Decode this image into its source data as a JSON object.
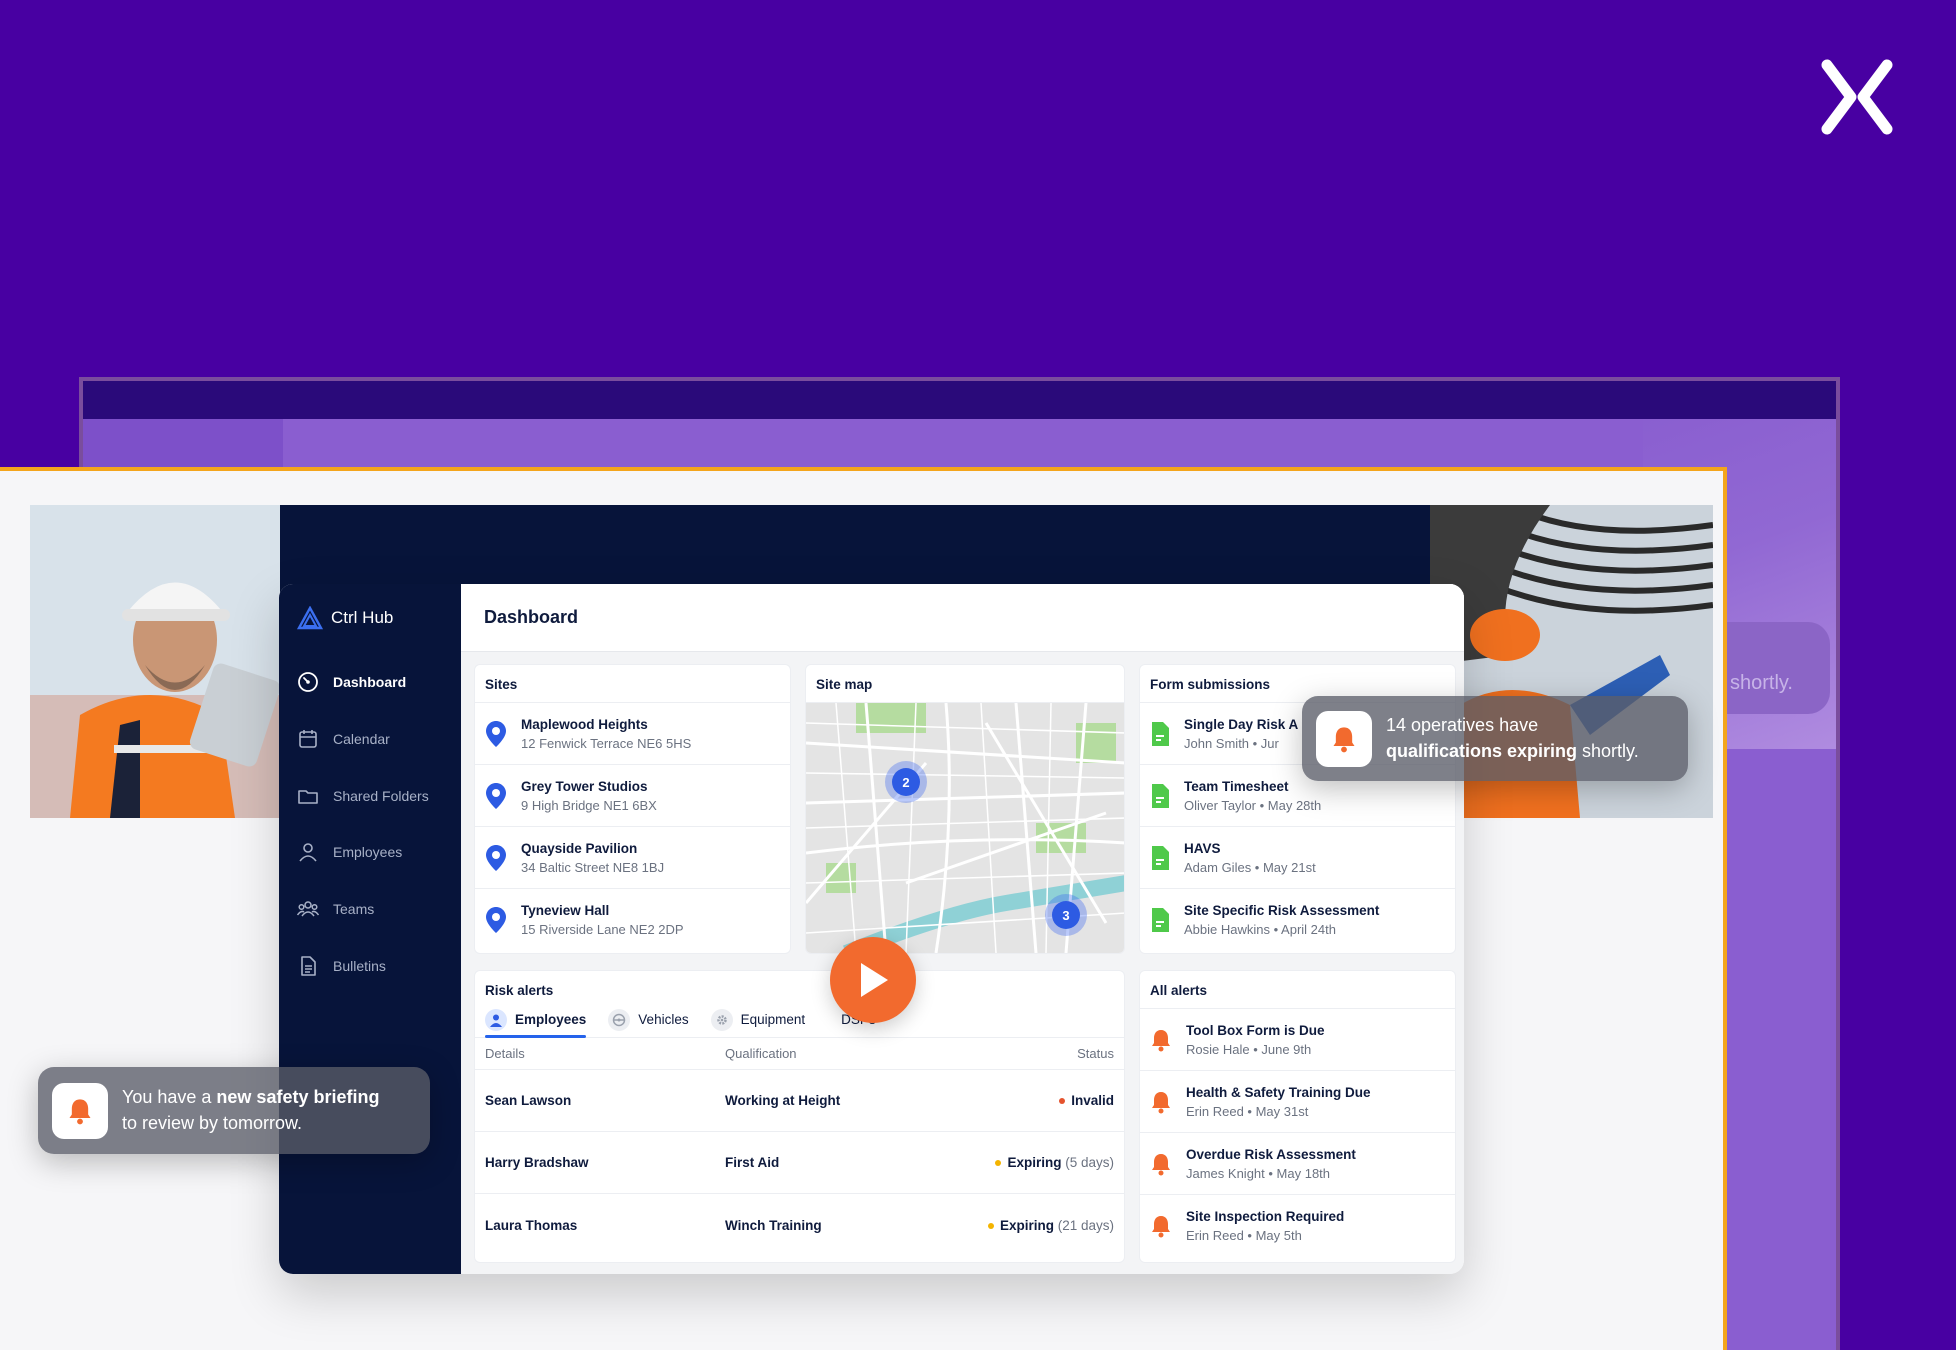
{
  "app": {
    "name": "Ctrl Hub",
    "page_title": "Dashboard"
  },
  "colors": {
    "background": "#4800a2",
    "accent": "#f4a51c",
    "sidebar": "#07143a",
    "primary": "#2563eb",
    "alert": "#f26a2e",
    "form_icon": "#4fc94a"
  },
  "sidebar": {
    "items": [
      {
        "label": "Dashboard",
        "icon": "gauge-icon",
        "active": true
      },
      {
        "label": "Calendar",
        "icon": "calendar-icon",
        "active": false
      },
      {
        "label": "Shared Folders",
        "icon": "folder-icon",
        "active": false
      },
      {
        "label": "Employees",
        "icon": "person-icon",
        "active": false
      },
      {
        "label": "Teams",
        "icon": "group-icon",
        "active": false
      },
      {
        "label": "Bulletins",
        "icon": "document-icon",
        "active": false
      }
    ]
  },
  "sites": {
    "title": "Sites",
    "items": [
      {
        "name": "Maplewood Heights",
        "address": "12 Fenwick Terrace NE6 5HS"
      },
      {
        "name": "Grey Tower Studios",
        "address": "9 High Bridge NE1 6BX"
      },
      {
        "name": "Quayside Pavilion",
        "address": "34 Baltic Street NE8 1BJ"
      },
      {
        "name": "Tyneview Hall",
        "address": "15 Riverside Lane NE2 2DP"
      }
    ]
  },
  "site_map": {
    "title": "Site map",
    "clusters": [
      "2",
      "3"
    ]
  },
  "forms": {
    "title": "Form submissions",
    "items": [
      {
        "name": "Single Day Risk A",
        "meta": "John Smith • Jur"
      },
      {
        "name": "Team Timesheet",
        "meta": "Oliver Taylor • May 28th"
      },
      {
        "name": "HAVS",
        "meta": "Adam Giles • May 21st"
      },
      {
        "name": "Site Specific Risk Assessment",
        "meta": "Abbie Hawkins • April 24th"
      }
    ]
  },
  "risk": {
    "title": "Risk alerts",
    "tabs": [
      {
        "label": "Employees",
        "icon": "person-icon",
        "active": true
      },
      {
        "label": "Vehicles",
        "icon": "steering-wheel-icon",
        "active": false
      },
      {
        "label": "Equipment",
        "icon": "gear-icon",
        "active": false
      },
      {
        "label": "DSPs",
        "icon": "",
        "active": false
      }
    ],
    "columns": [
      "Details",
      "Qualification",
      "Status"
    ],
    "rows": [
      {
        "name": "Sean Lawson",
        "qualification": "Working at Height",
        "status": "Invalid",
        "extra": "",
        "dot": "#e5532d"
      },
      {
        "name": "Harry Bradshaw",
        "qualification": "First Aid",
        "status": "Expiring",
        "extra": "(5 days)",
        "dot": "#f4b400"
      },
      {
        "name": "Laura Thomas",
        "qualification": "Winch Training",
        "status": "Expiring",
        "extra": "(21 days)",
        "dot": "#f4b400"
      }
    ]
  },
  "alerts": {
    "title": "All alerts",
    "items": [
      {
        "name": "Tool Box Form is Due",
        "meta": "Rosie Hale • June 9th"
      },
      {
        "name": "Health & Safety Training Due",
        "meta": "Erin Reed • May 31st"
      },
      {
        "name": "Overdue Risk Assessment",
        "meta": "James Knight • May 18th"
      },
      {
        "name": "Site Inspection Required",
        "meta": "Erin Reed • May 5th"
      }
    ]
  },
  "toast_right": {
    "pre": "14 operatives have",
    "bold": "qualifications expiring",
    "post": " shortly."
  },
  "toast_left": {
    "pre": "You have a ",
    "bold": "new safety briefing",
    "post": "to review by tomorrow."
  },
  "bg_toast_fragment": "shortly."
}
